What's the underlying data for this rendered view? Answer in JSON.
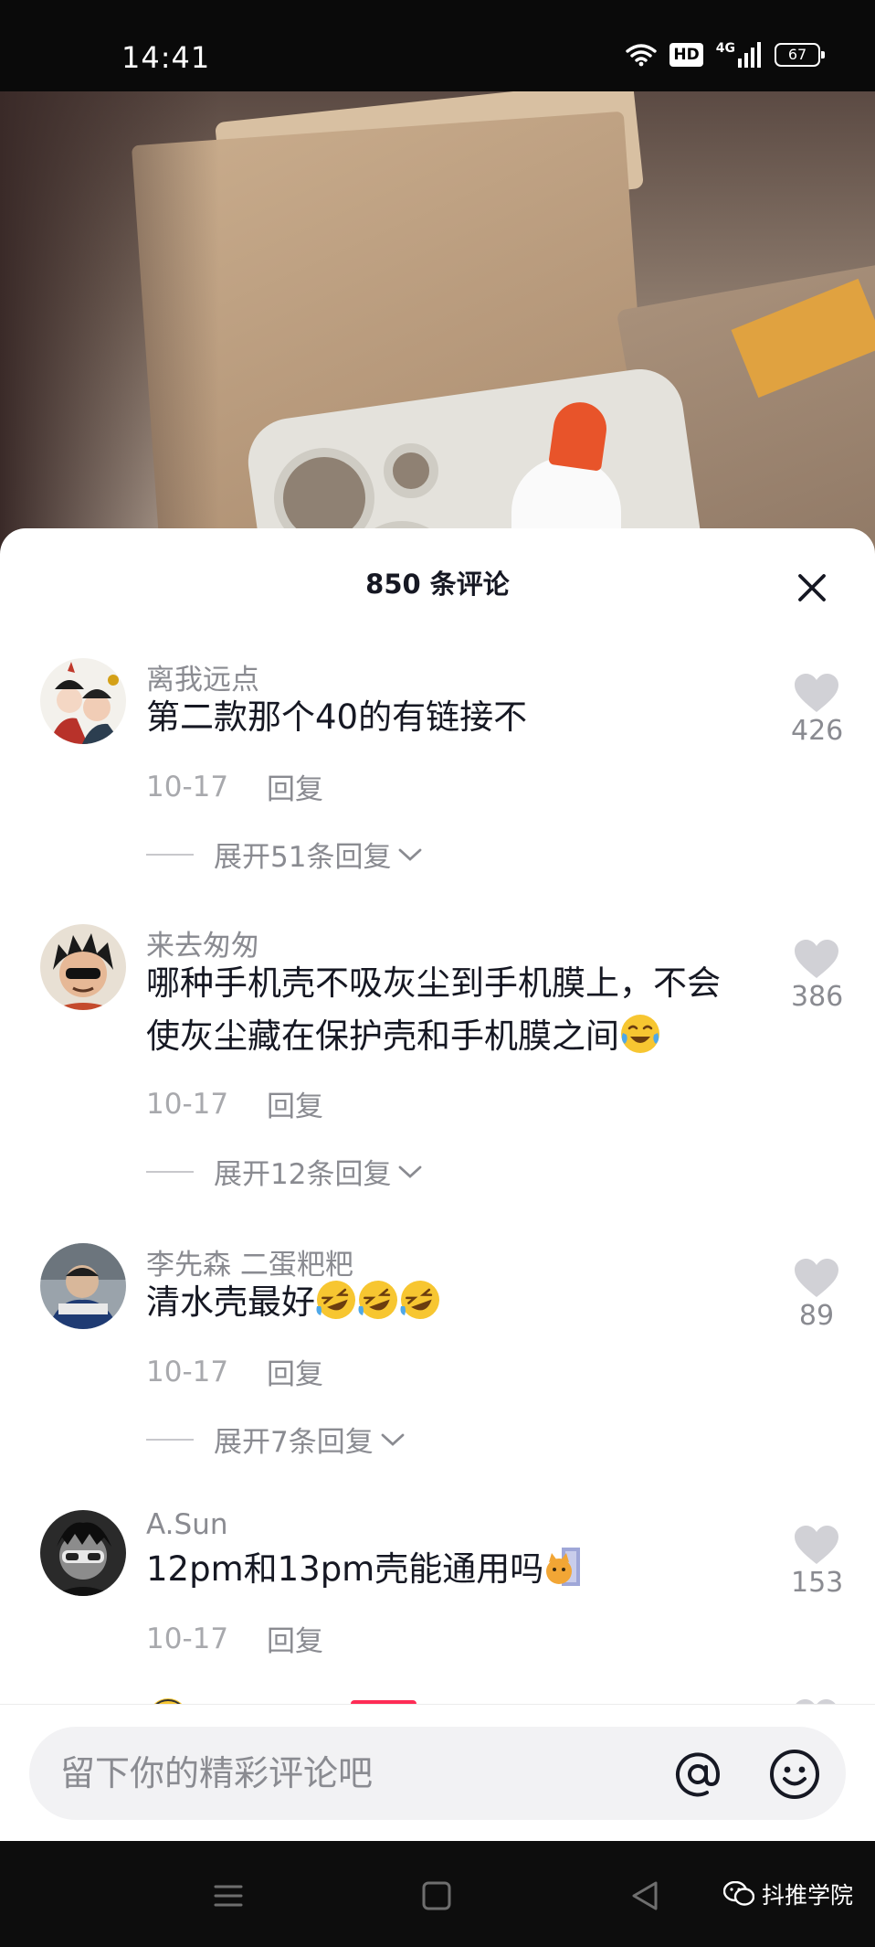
{
  "status_bar": {
    "time": "14:41",
    "hd_badge": "HD",
    "network": "4G",
    "battery_level": "67"
  },
  "comments_panel": {
    "title": "850 条评论",
    "comments": [
      {
        "username": "离我远点",
        "text": "第二款那个40的有链接不",
        "date": "10-17",
        "reply_label": "回复",
        "expand_label": "展开51条回复",
        "likes": "426"
      },
      {
        "username": "来去匆匆",
        "text": "哪种手机壳不吸灰尘到手机膜上，不会使灰尘藏在保护壳和手机膜之间",
        "emoji": "crying-laughing-emoji",
        "date": "10-17",
        "reply_label": "回复",
        "expand_label": "展开12条回复",
        "likes": "386"
      },
      {
        "username": "李先森 二蛋粑粑",
        "text": "清水壳最好",
        "emoji": "rolling-laughing-emoji x3",
        "date": "10-17",
        "reply_label": "回复",
        "expand_label": "展开7条回复",
        "likes": "89"
      },
      {
        "username": "A.Sun",
        "text": "12pm和13pm壳能通用吗",
        "emoji": "peeking-cat-emoji",
        "date": "10-17",
        "reply_label": "回复",
        "likes": "153"
      }
    ]
  },
  "input_bar": {
    "placeholder": "留下你的精彩评论吧",
    "mention_icon": "at-icon",
    "emoji_icon": "smiley-icon"
  },
  "nav_bar": {
    "watermark_text": "抖推学院"
  },
  "colors": {
    "text_primary": "#161823",
    "text_secondary": "#8a8b91",
    "like_gray": "#d1d1d6",
    "background": "#ffffff"
  }
}
